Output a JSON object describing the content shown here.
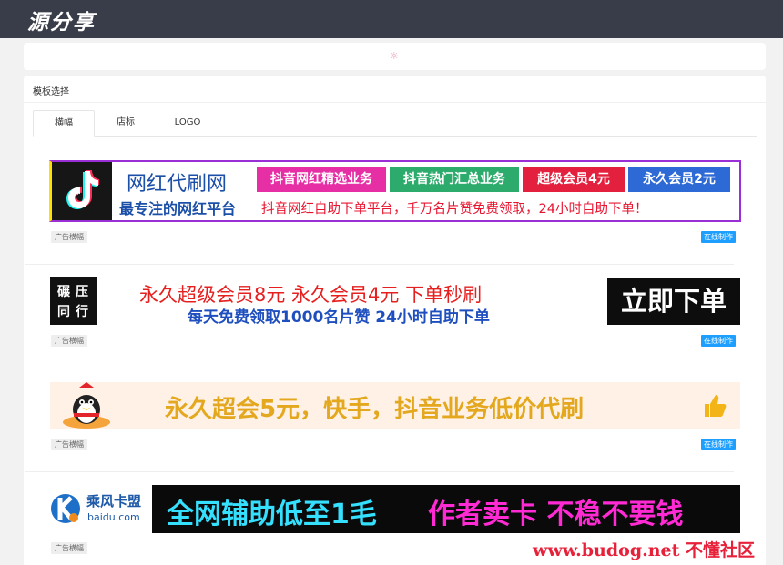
{
  "header": {
    "logo_text": "源分享"
  },
  "loader": {
    "glyph": "☼"
  },
  "panel": {
    "title": "模板选择"
  },
  "tabs": [
    {
      "label": "横幅"
    },
    {
      "label": "店标"
    },
    {
      "label": "LOGO"
    }
  ],
  "banners": [
    {
      "title": "网红代刷网",
      "subtitle": "最专注的网红平台",
      "boxes": [
        {
          "label": "抖音网红精选业务",
          "color": "#e62fa5"
        },
        {
          "label": "抖音热门汇总业务",
          "color": "#2dab6c"
        },
        {
          "label": "超级会员4元",
          "color": "#e3203e"
        },
        {
          "label": "永久会员2元",
          "color": "#2d6ad6"
        }
      ],
      "slogan": "抖音网红自助下单平台，千万名片赞免费领取，24小时自助下单！",
      "tag": "广告横幅",
      "button": "在线制作"
    },
    {
      "logo_line1": "碾压",
      "logo_line2": "同行",
      "line1": "永久超级会员8元  永久会员4元  下单秒刷",
      "line2": "每天免费领取1000名片赞  24小时自助下单",
      "cta": "立即下单",
      "tag": "广告横幅",
      "button": "在线制作"
    },
    {
      "text": "永久超会5元，快手，抖音业务低价代刷",
      "tag": "广告横幅",
      "button": "在线制作"
    },
    {
      "logo_name": "乘风卡盟",
      "logo_domain": "baidu.com",
      "text1": "全网辅助低至1毛",
      "text2": "作者卖卡 不稳不要钱",
      "tag": "广告横幅"
    }
  ],
  "watermark": "www.budog.net 不懂社区",
  "colors": {
    "topbar": "#393d49",
    "accent_button": "#1e9fff",
    "banner1_border": "#9a2fd6"
  }
}
